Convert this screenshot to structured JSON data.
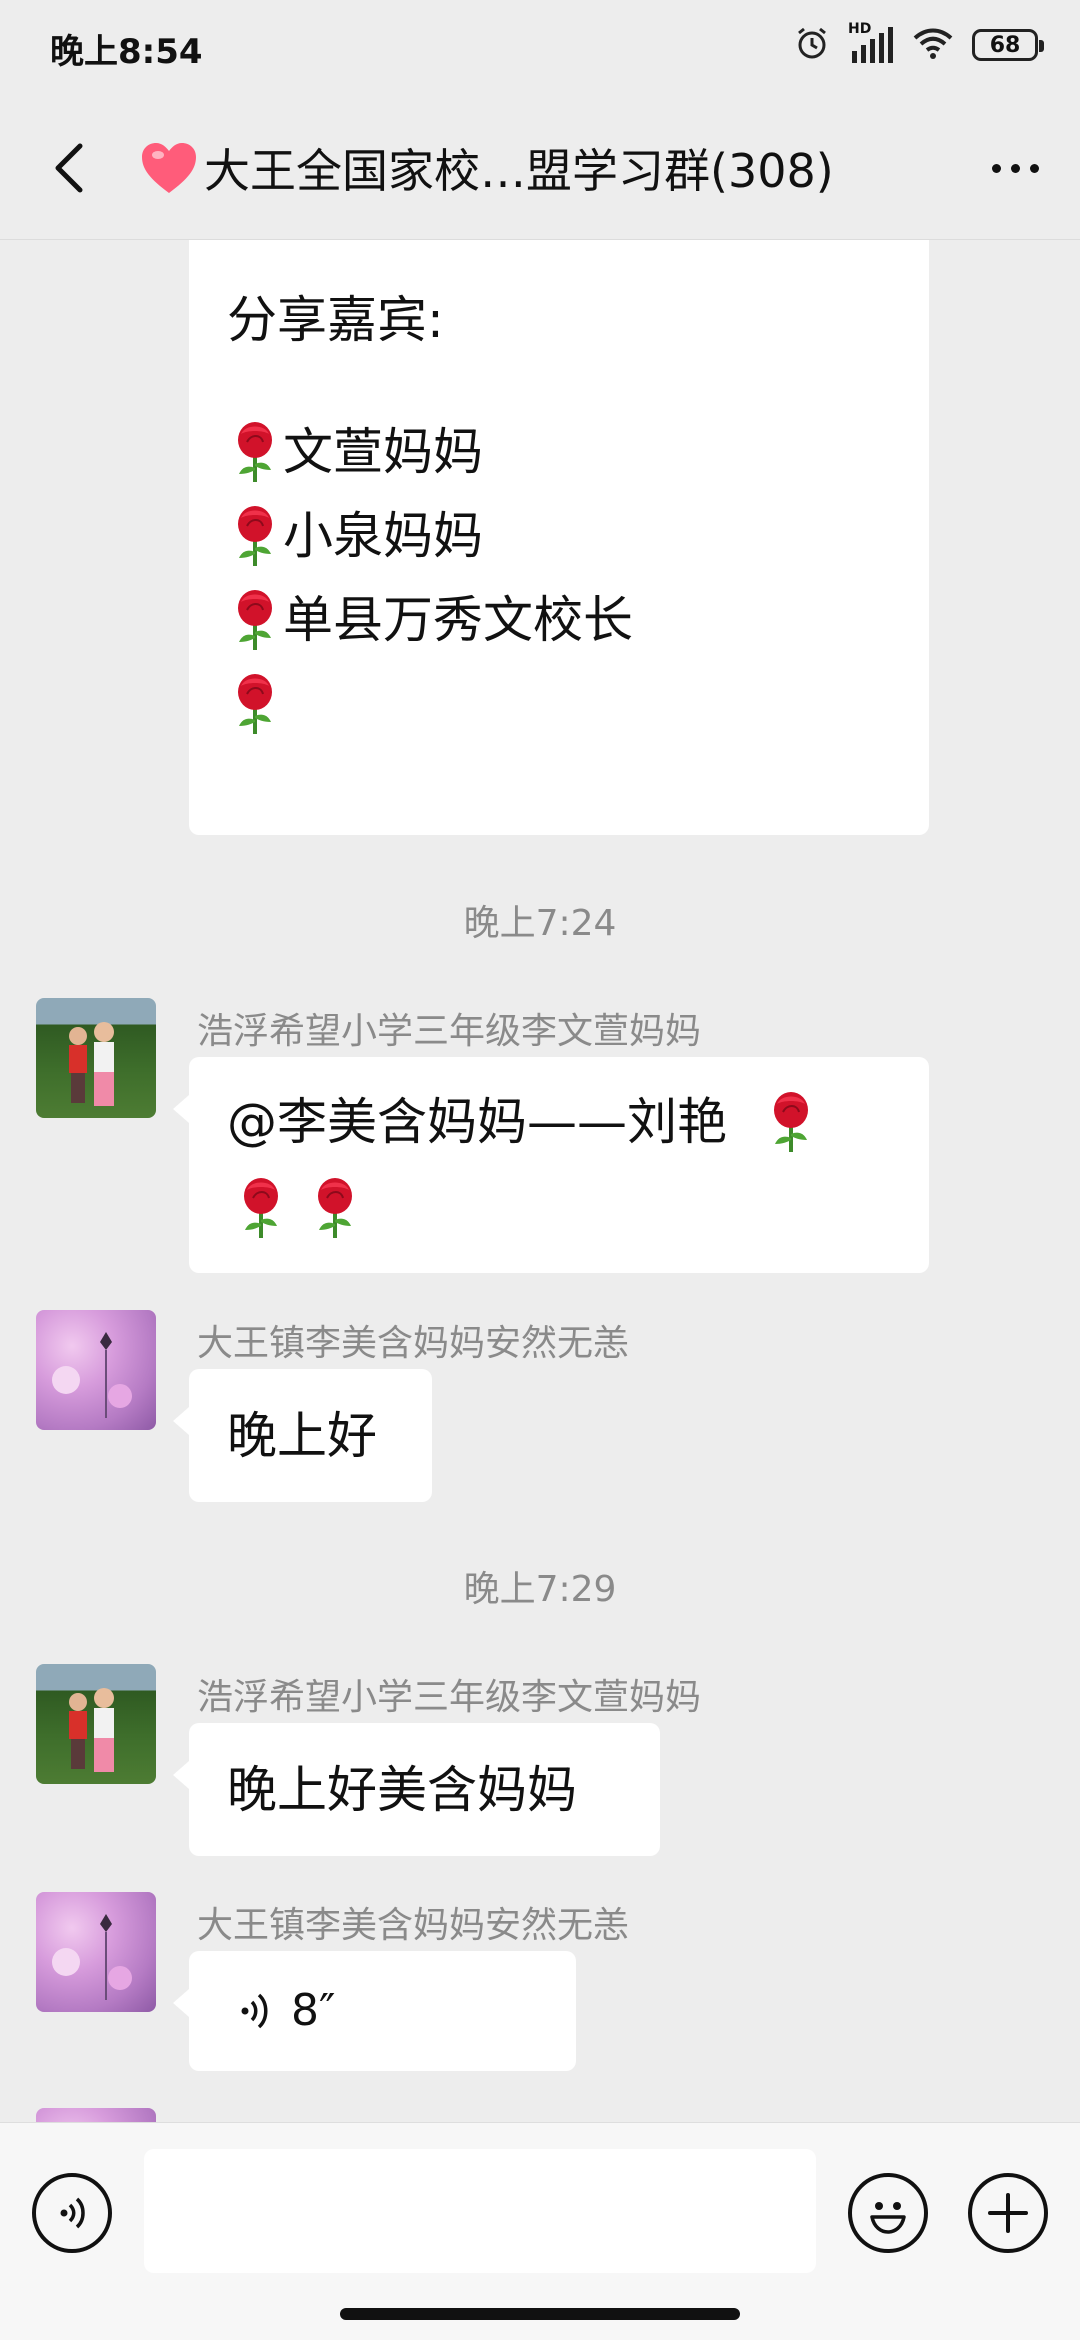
{
  "status_bar": {
    "time": "晚上8:54",
    "network": "HD",
    "battery": "68"
  },
  "header": {
    "title": "大王全国家校…盟学习群(308)"
  },
  "messages": {
    "card": {
      "label": "分享嘉宾:",
      "guests": [
        "文萱妈妈",
        " 小泉妈妈",
        "单县万秀文校长",
        ""
      ]
    },
    "time1": "晚上7:24",
    "msg1": {
      "sender": "浩浮希望小学三年级李文萱妈妈",
      "text": "@李美含妈妈——刘艳"
    },
    "msg2": {
      "sender": "大王镇李美含妈妈安然无恙",
      "text": "晚上好"
    },
    "time2": "晚上7:29",
    "msg3": {
      "sender": "浩浮希望小学三年级李文萱妈妈",
      "text": "晚上好美含妈妈"
    },
    "msg4": {
      "sender": "大王镇李美含妈妈安然无恙",
      "voice_duration": "8″"
    }
  },
  "icons": {
    "back": "chevron-left-icon",
    "more": "more-icon",
    "voice": "voice-icon",
    "emoji": "emoji-icon",
    "add": "plus-icon",
    "rose": "rose-icon",
    "heart": "heart-icon"
  },
  "colors": {
    "background": "#ededed",
    "bubble": "#ffffff",
    "meta_text": "#8a8a8a",
    "heart": "#ff5c7a",
    "rose": "#d1122a"
  }
}
